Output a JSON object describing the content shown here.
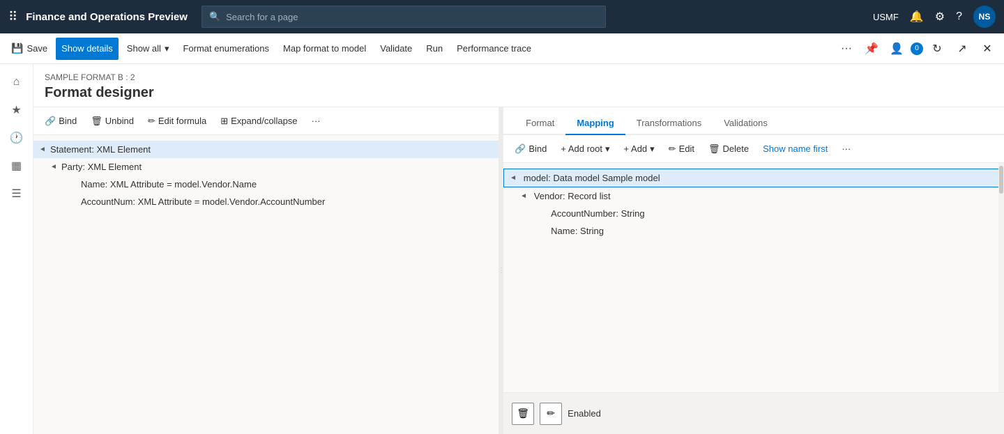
{
  "app": {
    "title": "Finance and Operations Preview",
    "search_placeholder": "Search for a page"
  },
  "topnav": {
    "usmf": "USMF",
    "avatar": "NS"
  },
  "commandbar": {
    "save": "Save",
    "show_details": "Show details",
    "show_all": "Show all",
    "format_enumerations": "Format enumerations",
    "map_format_to_model": "Map format to model",
    "validate": "Validate",
    "run": "Run",
    "performance_trace": "Performance trace",
    "notification_count": "0"
  },
  "page": {
    "breadcrumb": "SAMPLE FORMAT B : 2",
    "title": "Format designer"
  },
  "left_panel": {
    "toolbar": {
      "bind": "Bind",
      "unbind": "Unbind",
      "edit_formula": "Edit formula",
      "expand_collapse": "Expand/collapse",
      "more": "···"
    },
    "tree": [
      {
        "level": 0,
        "arrow": "◄",
        "label": "Statement: XML Element",
        "selected": true
      },
      {
        "level": 1,
        "arrow": "◄",
        "label": "Party: XML Element",
        "selected": false
      },
      {
        "level": 2,
        "arrow": "",
        "label": "Name: XML Attribute = model.Vendor.Name",
        "selected": false
      },
      {
        "level": 2,
        "arrow": "",
        "label": "AccountNum: XML Attribute = model.Vendor.AccountNumber",
        "selected": false
      }
    ]
  },
  "right_panel": {
    "tabs": [
      {
        "id": "format",
        "label": "Format",
        "active": false
      },
      {
        "id": "mapping",
        "label": "Mapping",
        "active": true
      },
      {
        "id": "transformations",
        "label": "Transformations",
        "active": false
      },
      {
        "id": "validations",
        "label": "Validations",
        "active": false
      }
    ],
    "toolbar": {
      "bind": "Bind",
      "add_root": "+ Add root",
      "add": "+ Add",
      "edit": "Edit",
      "delete": "Delete",
      "show_name_first": "Show name first",
      "more": "···"
    },
    "tree": [
      {
        "level": 0,
        "arrow": "◄",
        "label": "model: Data model Sample model",
        "selected": true
      },
      {
        "level": 1,
        "arrow": "◄",
        "label": "Vendor: Record list",
        "selected": false
      },
      {
        "level": 2,
        "arrow": "",
        "label": "AccountNumber: String",
        "selected": false
      },
      {
        "level": 2,
        "arrow": "",
        "label": "Name: String",
        "selected": false
      }
    ],
    "bottom": {
      "status": "Enabled"
    }
  }
}
